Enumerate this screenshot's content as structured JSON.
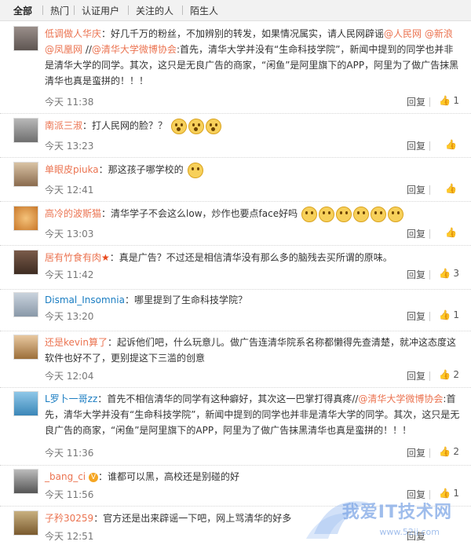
{
  "tabs": [
    "全部",
    "热门",
    "认证用户",
    "关注的人",
    "陌生人"
  ],
  "reply_label": "回复",
  "comments": [
    {
      "user": "低调做人华庆",
      "text_parts": [
        "好几千万的粉丝，不加辨别的转发，如果情况属实，请人民网辟谣",
        "@人民网",
        " ",
        "@新浪",
        " ",
        "@凤凰网",
        " //",
        "@清华大学微博协会",
        ":首先，清华大学并没有“生命科技学院”，新闻中提到的同学也并非是清华大学的同学。其次，这只是无良广告的商家，“闲鱼”是阿里旗下的APP，阿里为了做广告抹黑清华也真是蛮拼的！！！"
      ],
      "time": "今天 11:38",
      "likes": "1"
    },
    {
      "user": "南派三淑",
      "text": "打人民网的脸？？",
      "time": "今天 13:23",
      "likes": ""
    },
    {
      "user": "单眼皮piuka",
      "text": "那这孩子哪学校的",
      "time": "今天 12:41",
      "likes": ""
    },
    {
      "user": "高冷的波斯猫",
      "text": "清华学子不会这么low，炒作也要点face好吗",
      "time": "今天 13:03",
      "likes": ""
    },
    {
      "user": "居有竹食有肉",
      "text": "真是广告？不过还是相信清华没有那么多的脑残去买所谓的原味。",
      "time": "今天 11:42",
      "likes": "3"
    },
    {
      "user": "Dismal_Insomnia",
      "text": "哪里提到了生命科技学院？",
      "time": "今天 13:20",
      "likes": "1"
    },
    {
      "user": "还是kevin算了",
      "text": "起诉他们吧，什么玩意儿。做广告连清华院系名称都懒得先查清楚，就冲这态度这软件也好不了，更别提这下三滥的创意",
      "time": "今天 12:04",
      "likes": "2"
    },
    {
      "user": "L罗卜一哥zz",
      "text_parts": [
        "首先不相信清华的同学有这种癖好，其次这一巴掌打得真疼//",
        "@清华大学微博协会",
        ":首先，清华大学并没有“生命科技学院”，新闻中提到的同学也并非是清华大学的同学。其次，这只是无良广告的商家，“闲鱼”是阿里旗下的APP，阿里为了做广告抹黑清华也真是蛮拼的！！！"
      ],
      "time": "今天 11:36",
      "likes": "2"
    },
    {
      "user": "_bang_ci",
      "text": "谁都可以黑，高校还是别碰的好",
      "time": "今天 11:56",
      "likes": "1"
    },
    {
      "user": "子矜30259",
      "text": "官方还是出来辟谣一下吧，网上骂清华的好多",
      "time": "今天 12:51",
      "likes": ""
    }
  ],
  "watermark": {
    "text": "我爱IT技术网",
    "url": "www.52ij.com"
  },
  "icons": {
    "like": "thumbs-up-icon",
    "emoji": "smiley-icon",
    "verified": "v-badge-icon",
    "star": "star-icon"
  }
}
